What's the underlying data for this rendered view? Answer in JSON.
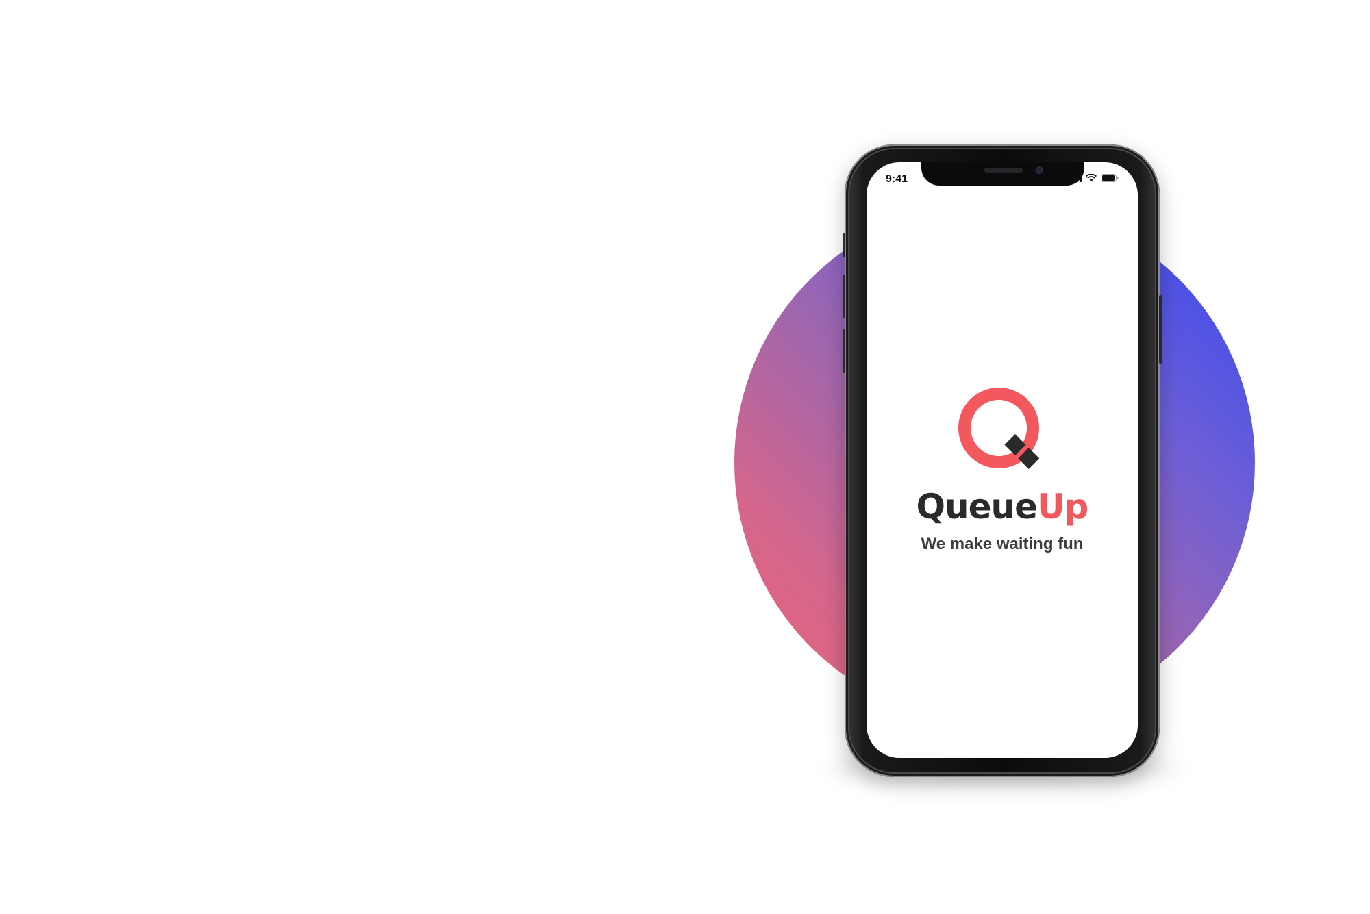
{
  "status_bar": {
    "time": "9:41",
    "icons": [
      "cellular-signal-icon",
      "wifi-icon",
      "battery-icon"
    ]
  },
  "app": {
    "brand_primary": "Queue",
    "brand_accent": "Up",
    "tagline": "We make waiting fun",
    "logo": "queueup-q-logo-icon"
  },
  "colors": {
    "accent": "#f4585f",
    "dark": "#2a2a2a",
    "circle_gradient_start": "#2f45f2",
    "circle_gradient_end": "#ef6274"
  }
}
